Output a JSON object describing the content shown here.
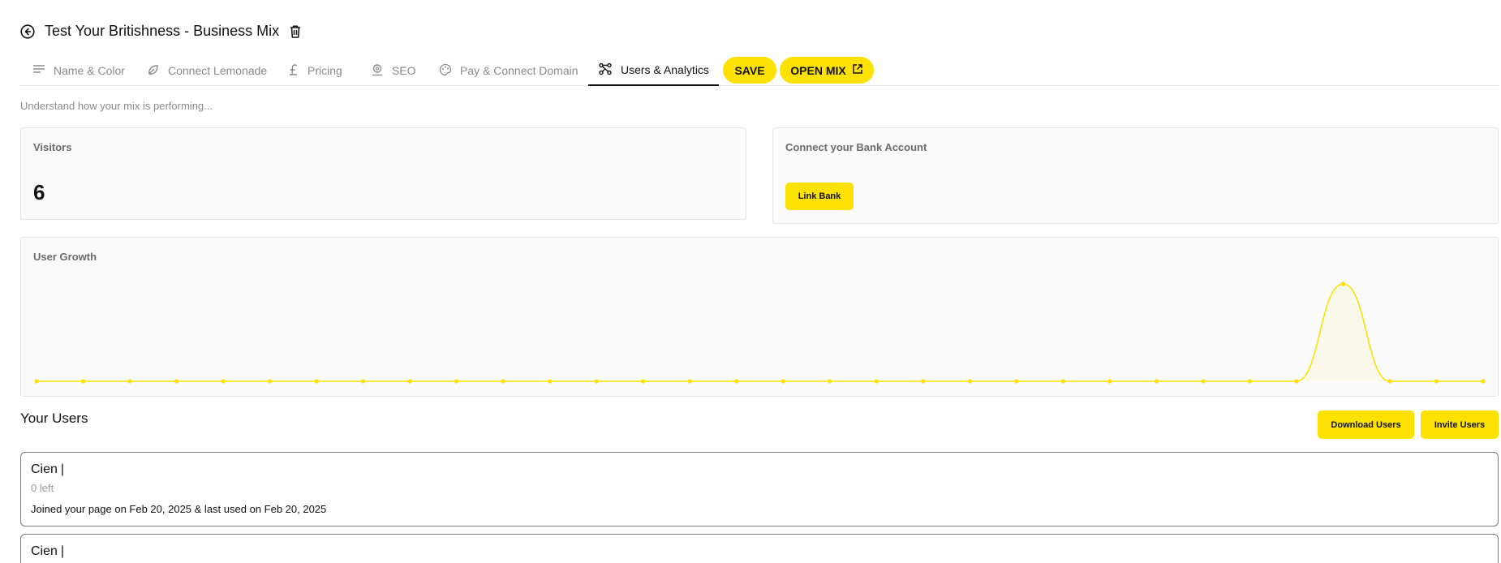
{
  "header": {
    "title": "Test Your Britishness - Business Mix"
  },
  "tabs": [
    {
      "label": "Name & Color",
      "icon": "lines-icon"
    },
    {
      "label": "Connect Lemonade",
      "icon": "leaf-icon"
    },
    {
      "label": "Pricing",
      "icon": "pound-icon"
    },
    {
      "label": "SEO",
      "icon": "location-icon"
    },
    {
      "label": "Pay & Connect Domain",
      "icon": "palette-icon"
    },
    {
      "label": "Users & Analytics",
      "icon": "network-icon",
      "active": true
    }
  ],
  "actions": {
    "save_label": "SAVE",
    "open_mix_label": "OPEN MIX"
  },
  "subtitle": "Understand how your mix is performing...",
  "visitors": {
    "label": "Visitors",
    "value": "6"
  },
  "bank": {
    "label": "Connect your Bank Account",
    "button_label": "Link Bank"
  },
  "growth": {
    "label": "User Growth"
  },
  "chart_data": {
    "type": "line",
    "title": "User Growth",
    "series": [
      {
        "values": [
          0,
          0,
          0,
          0,
          0,
          0,
          0,
          0,
          0,
          0,
          0,
          0,
          0,
          0,
          0,
          0,
          0,
          0,
          0,
          0,
          0,
          0,
          0,
          0,
          0,
          0,
          0,
          0,
          1,
          0,
          0,
          0
        ]
      }
    ],
    "ylim": [
      0,
      1
    ],
    "grid": false,
    "color": "#fde100"
  },
  "users_section": {
    "heading": "Your Users",
    "download_label": "Download Users",
    "invite_label": "Invite Users",
    "users": [
      {
        "name": "Cien",
        "remaining": "0 left",
        "joined": "Joined your page on Feb 20, 2025 & last used on Feb 20, 2025"
      },
      {
        "name": "Cien"
      }
    ]
  },
  "colors": {
    "accent": "#fde100",
    "text": "#111111",
    "muted": "#8a8a8a"
  }
}
